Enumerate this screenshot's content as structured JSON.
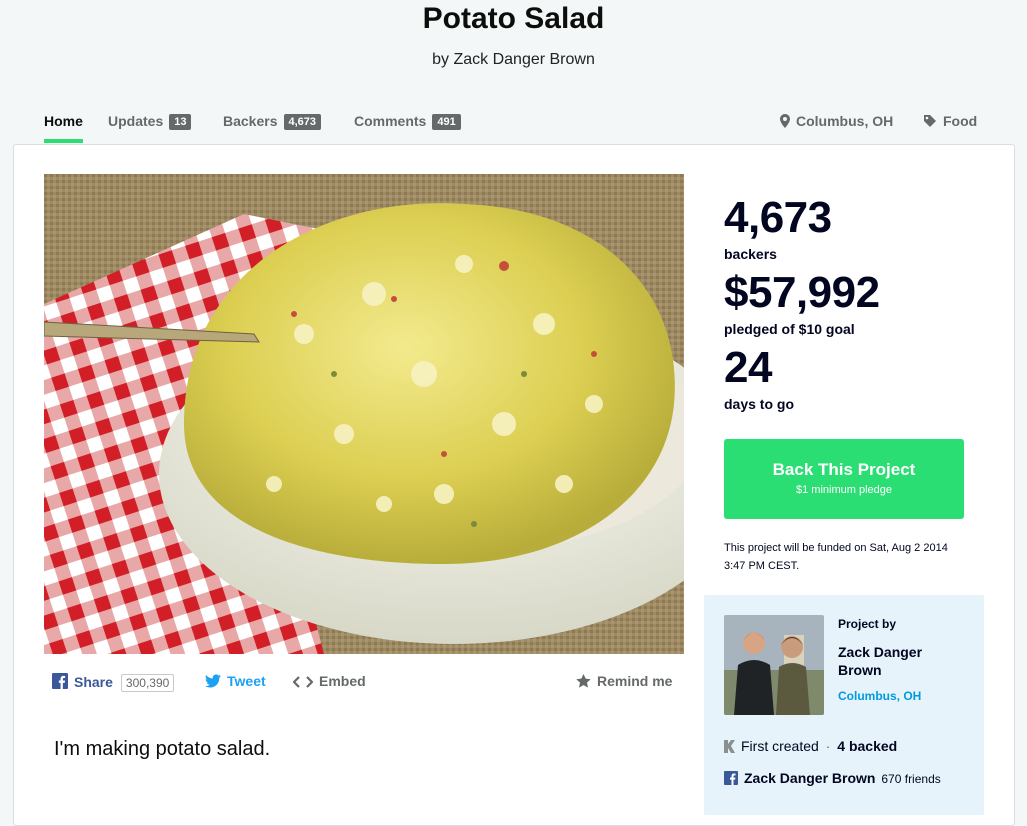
{
  "project": {
    "title": "Potato Salad",
    "byline": "by Zack Danger Brown",
    "blurb": "I'm making potato salad."
  },
  "nav": {
    "home": "Home",
    "updates": "Updates",
    "updates_count": "13",
    "backers": "Backers",
    "backers_count": "4,673",
    "comments": "Comments",
    "comments_count": "491",
    "location": "Columbus, OH",
    "category": "Food"
  },
  "stats": {
    "backers_value": "4,673",
    "backers_label": "backers",
    "pledged_value": "$57,992",
    "pledged_label": "pledged of $10 goal",
    "days_value": "24",
    "days_label": "days to go"
  },
  "cta": {
    "label": "Back This Project",
    "sub": "$1 minimum pledge",
    "funded_note": "This project will be funded on Sat, Aug 2 2014 3:47 PM CEST."
  },
  "creator": {
    "heading": "Project by",
    "name": "Zack Danger Brown",
    "location": "Columbus, OH",
    "first_created": "First created",
    "separator": "·",
    "backed": "4 backed",
    "fb_name": "Zack Danger Brown",
    "fb_friends": "670 friends"
  },
  "share": {
    "share_label": "Share",
    "share_count": "300,390",
    "tweet_label": "Tweet",
    "embed_label": "Embed",
    "remind_label": "Remind me"
  },
  "colors": {
    "accent": "#2bde73",
    "link_blue": "#009bde",
    "facebook": "#3b5998",
    "twitter": "#1da1f2",
    "nav_gray": "#656969"
  },
  "icons": {
    "location": "map-pin-icon",
    "category": "tag-icon",
    "facebook": "facebook-icon",
    "twitter": "twitter-bird-icon",
    "embed": "embed-code-icon",
    "remind": "star-icon",
    "kickstarter": "kickstarter-k-icon"
  }
}
